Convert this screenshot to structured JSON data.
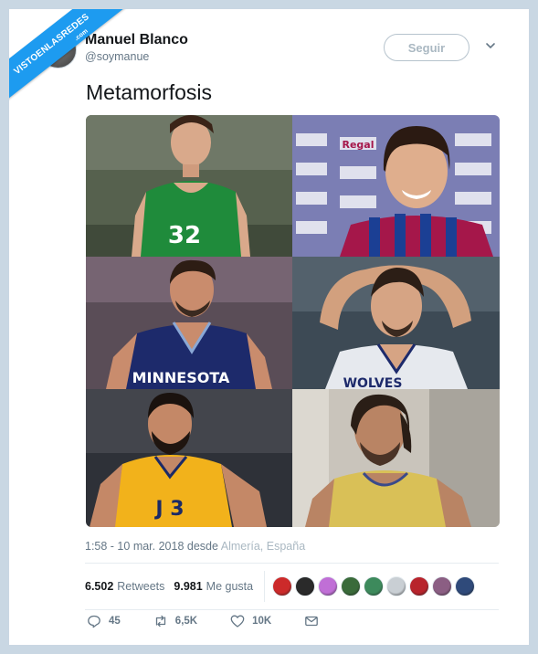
{
  "watermark": {
    "text": "VISTOENLASREDES",
    "sub": ".com"
  },
  "user": {
    "name": "Manuel Blanco",
    "handle": "@soymanue"
  },
  "follow_label": "Seguir",
  "tweet_text": "Metamorfosis",
  "photos": [
    {
      "jersey_text": "32",
      "jersey_color": "#1f8b3b"
    },
    {
      "jersey_text": "Regal",
      "jersey_color": "#a5174a"
    },
    {
      "jersey_text": "MINNESOTA",
      "jersey_color": "#1d2a6b"
    },
    {
      "jersey_text": "WOLVES",
      "jersey_color": "#e6e9ee"
    },
    {
      "jersey_text": "J 3",
      "jersey_color": "#f2b21b"
    },
    {
      "jersey_text": "",
      "jersey_color": "#d9c057"
    }
  ],
  "timestamp": {
    "time": "1:58 - 10 mar. 2018 desde",
    "location": "Almería, España"
  },
  "stats": {
    "retweets_num": "6.502",
    "retweets_label": "Retweets",
    "likes_num": "9.981",
    "likes_label": "Me gusta",
    "liker_colors": [
      "#cc2a2a",
      "#2a2a2a",
      "#c06fd6",
      "#3a6b3a",
      "#3d8a5c",
      "#c9cfd4",
      "#b8242c",
      "#8b5e83",
      "#2f4a7a"
    ]
  },
  "actions": {
    "replies": "45",
    "retweets": "6,5K",
    "likes": "10K"
  },
  "colors": {
    "accent": "#1d9bf0",
    "muted": "#657786",
    "border": "#e6ecf0"
  }
}
